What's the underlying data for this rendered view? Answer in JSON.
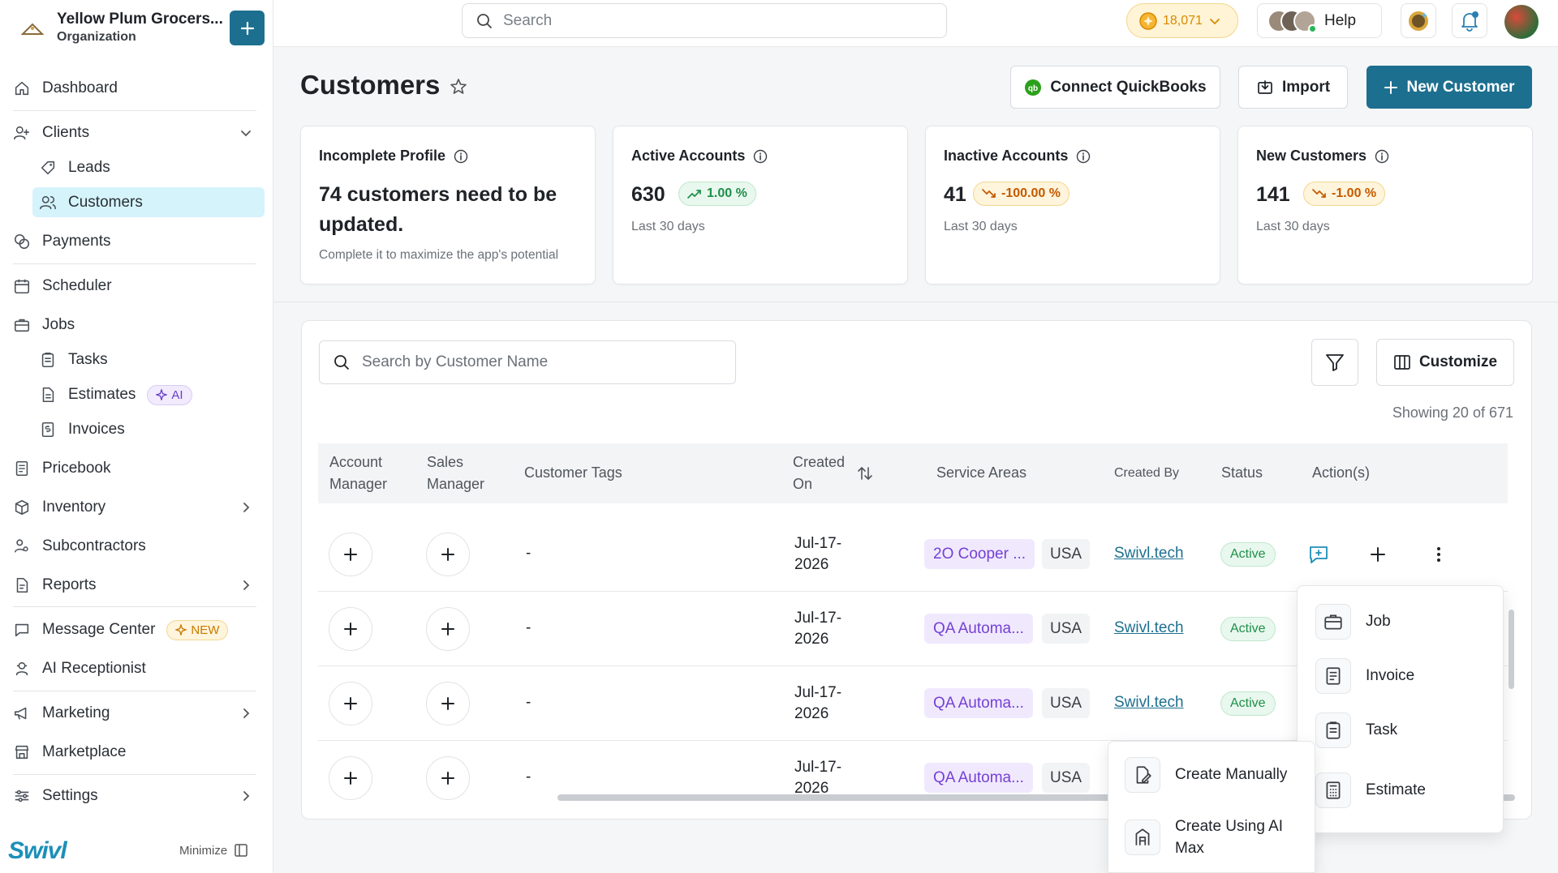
{
  "org": {
    "name": "Yellow Plum Grocers...",
    "subtitle": "Organization"
  },
  "topbar": {
    "search_placeholder": "Search",
    "coins": "18,071",
    "help": "Help"
  },
  "sidebar": {
    "dashboard": "Dashboard",
    "clients": "Clients",
    "leads": "Leads",
    "customers": "Customers",
    "payments": "Payments",
    "scheduler": "Scheduler",
    "jobs": "Jobs",
    "tasks": "Tasks",
    "estimates": "Estimates",
    "estimates_badge": "AI",
    "invoices": "Invoices",
    "pricebook": "Pricebook",
    "inventory": "Inventory",
    "subcontractors": "Subcontractors",
    "reports": "Reports",
    "message_center": "Message Center",
    "message_badge": "NEW",
    "ai_receptionist": "AI Receptionist",
    "marketing": "Marketing",
    "marketplace": "Marketplace",
    "settings": "Settings",
    "brand": "Swivl",
    "minimize": "Minimize"
  },
  "header": {
    "title": "Customers",
    "connect_qb": "Connect QuickBooks",
    "import": "Import",
    "new_customer": "New Customer"
  },
  "cards": {
    "incomplete": {
      "title": "Incomplete Profile",
      "big": "74 customers need to be updated.",
      "note": "Complete it to maximize the app's potential"
    },
    "active": {
      "title": "Active Accounts",
      "value": "630",
      "trend": "1.00 %",
      "note": "Last 30 days"
    },
    "inactive": {
      "title": "Inactive Accounts",
      "value": "41",
      "trend": "-100.00 %",
      "note": "Last 30 days"
    },
    "new": {
      "title": "New Customers",
      "value": "141",
      "trend": "-1.00 %",
      "note": "Last 30 days"
    }
  },
  "table": {
    "search_placeholder": "Search by Customer Name",
    "customize": "Customize",
    "showing": "Showing 20 of 671",
    "columns": {
      "account_manager": "Account Manager",
      "sales_manager": "Sales Manager",
      "customer_tags": "Customer Tags",
      "created_on": "Created On",
      "service_areas": "Service Areas",
      "created_by": "Created By",
      "status": "Status",
      "actions": "Action(s)"
    },
    "rows": [
      {
        "tags": "-",
        "date_line1": "Jul-17-",
        "date_line2": "2026",
        "service_tag": "2O Cooper ...",
        "area": "USA",
        "created_by": "Swivl.tech",
        "status": "Active"
      },
      {
        "tags": "-",
        "date_line1": "Jul-17-",
        "date_line2": "2026",
        "service_tag": "QA Automa...",
        "area": "USA",
        "created_by": "Swivl.tech",
        "status": "Active"
      },
      {
        "tags": "-",
        "date_line1": "Jul-17-",
        "date_line2": "2026",
        "service_tag": "QA Automa...",
        "area": "USA",
        "created_by": "Swivl.tech",
        "status": "Active"
      },
      {
        "tags": "-",
        "date_line1": "Jul-17-",
        "date_line2": "2026",
        "service_tag": "QA Automa...",
        "area": "USA"
      }
    ]
  },
  "action_menu": {
    "job": "Job",
    "invoice": "Invoice",
    "task": "Task",
    "estimate": "Estimate"
  },
  "create_menu": {
    "manual": "Create Manually",
    "ai_line1": "Create Using AI",
    "ai_line2": "Max"
  }
}
